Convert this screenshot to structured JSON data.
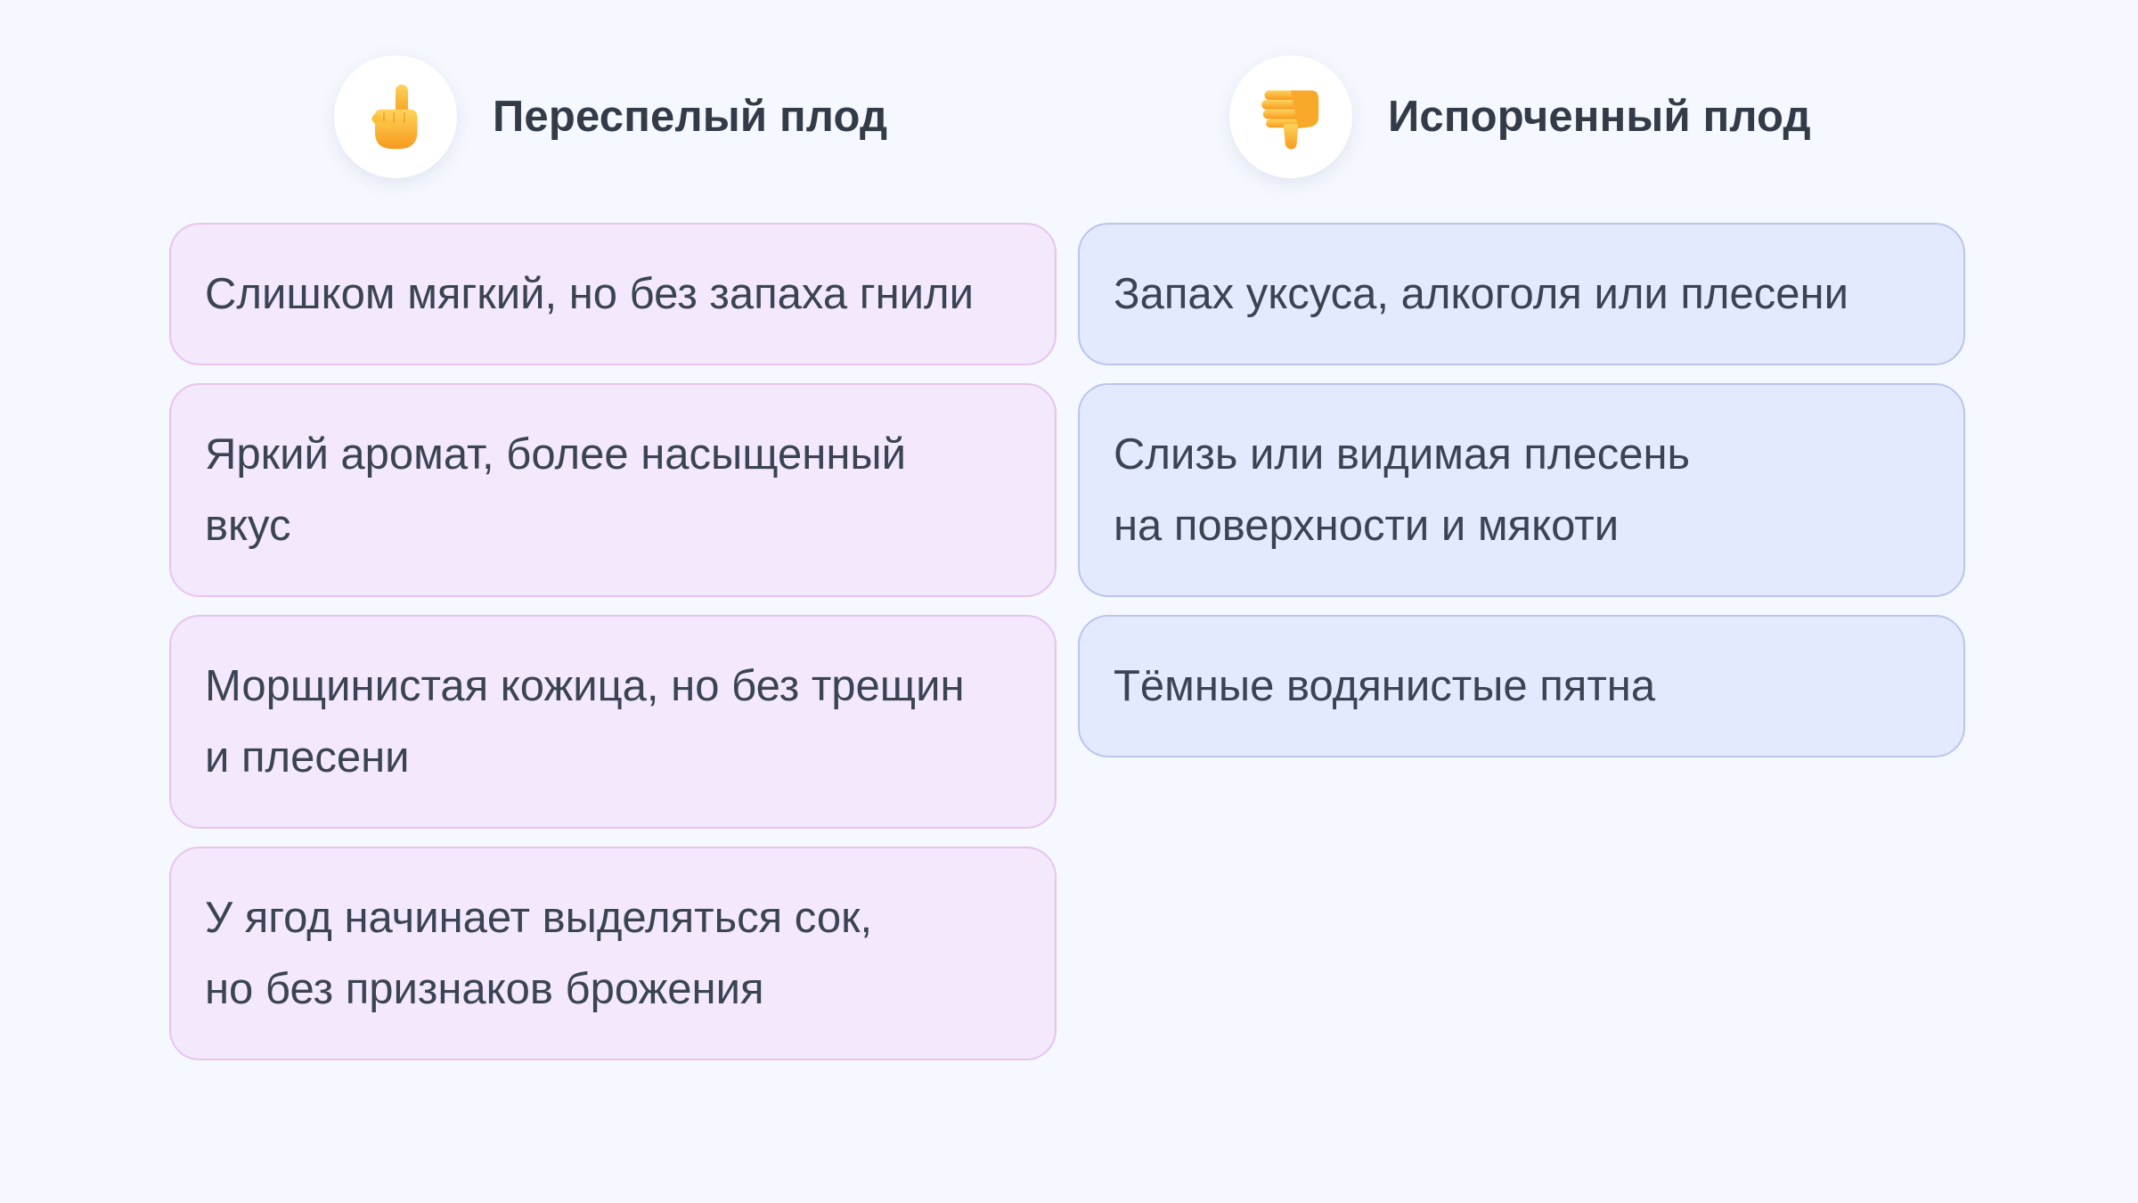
{
  "columns": {
    "left": {
      "icon": "point-up-hand-icon",
      "title": "Переспелый плод",
      "items": [
        "Слишком мягкий, но без запаха гнили",
        "Яркий аромат, более насыщенный\nвкус",
        "Морщинистая кожица, но без трещин\nи плесени",
        "У ягод начинает выделяться сок,\nно без признаков брожения"
      ]
    },
    "right": {
      "icon": "thumbs-down-icon",
      "title": "Испорченный плод",
      "items": [
        "Запах уксуса, алкоголя или плесени",
        "Слизь или видимая плесень\nна поверхности и мякоти",
        "Тёмные водянистые пятна"
      ]
    }
  },
  "colors": {
    "background": "#f5f8fe",
    "card_pink": "#f3e8fc",
    "card_pink_border": "#e7c4ef",
    "card_blue": "#e4eafd",
    "card_blue_border": "#b9c5ef",
    "text": "#3a4452",
    "emoji": "#fbb734"
  }
}
